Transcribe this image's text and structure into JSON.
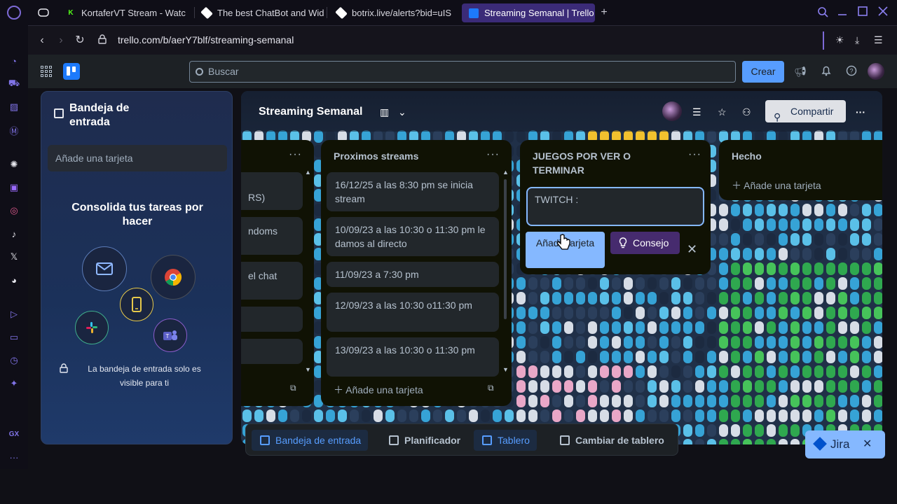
{
  "browser": {
    "tabs": [
      {
        "title": "KortaferVT Stream - Watc",
        "active": false
      },
      {
        "title": "The best ChatBot and Wid",
        "active": false
      },
      {
        "title": "botrix.live/alerts?bid=uIS",
        "active": false
      },
      {
        "title": "Streaming Semanal | Trello",
        "active": true
      }
    ],
    "new_tab": "+",
    "url": "trello.com/b/aerY7blf/streaming-semanal",
    "sidebar_bottom_label": "GX",
    "sidebar_more": "···"
  },
  "trello": {
    "search_placeholder": "Buscar",
    "create_label": "Crear"
  },
  "inbox": {
    "title": "Bandeja de entrada",
    "add_card_placeholder": "Añade una tarjeta",
    "headline": "Consolida tus tareas por hacer",
    "privacy_note": "La bandeja de entrada solo es visible para ti"
  },
  "board": {
    "title": "Streaming Semanal",
    "share_label": "Compartir",
    "lists": [
      {
        "title": "",
        "cards": [
          "RS)",
          "ndoms",
          "el chat",
          "",
          ""
        ]
      },
      {
        "title": "Proximos streams",
        "cards": [
          "16/12/25 a las 8:30 pm se inicia stream",
          "10/09/23 a las 10:30 o 11:30 pm le damos al directo",
          "11/09/23 a 7:30 pm",
          "12/09/23 a las 10:30 o11:30 pm",
          "13/09/23 a las 10:30 o 11:30 pm"
        ],
        "add_label": "Añade una tarjeta"
      },
      {
        "title": "JUEGOS POR VER O TERMINAR",
        "editor_value": "TWITCH :",
        "add_button": "Añadir tarjeta",
        "tip_button": "Consejo"
      },
      {
        "title": "Hecho",
        "add_label": "Añade una tarjeta"
      }
    ]
  },
  "bottom_nav": {
    "items": [
      "Bandeja de entrada",
      "Planificador",
      "Tablero",
      "Cambiar de tablero"
    ]
  },
  "jira": {
    "label": "Jira"
  }
}
